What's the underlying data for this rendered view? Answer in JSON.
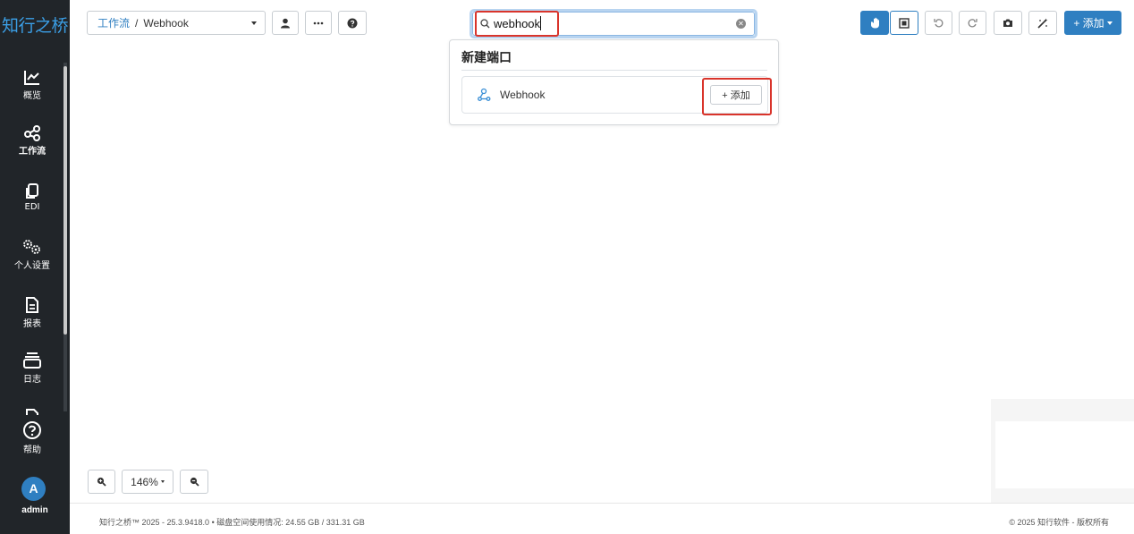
{
  "sidebar": {
    "logo": "知行之桥",
    "items": [
      {
        "label": "概览",
        "icon": "chart-line-icon"
      },
      {
        "label": "工作流",
        "icon": "share-nodes-icon"
      },
      {
        "label": "EDI",
        "icon": "copy-icon"
      },
      {
        "label": "个人设置",
        "icon": "gears-icon"
      },
      {
        "label": "报表",
        "icon": "file-lines-icon"
      },
      {
        "label": "日志",
        "icon": "stack-icon"
      },
      {
        "label": "帮助",
        "icon": "question-circle-icon"
      }
    ],
    "user": {
      "initial": "A",
      "name": "admin"
    }
  },
  "toolbar": {
    "breadcrumb_root": "工作流",
    "breadcrumb_sep": "/",
    "breadcrumb_current": "Webhook",
    "add_label": "+ 添加"
  },
  "search": {
    "value": "webhook"
  },
  "dropdown": {
    "section_title": "新建端口",
    "items": [
      {
        "label": "Webhook",
        "add_label": "+ 添加"
      }
    ]
  },
  "zoom": {
    "level": "146%"
  },
  "footer": {
    "left": "知行之桥™ 2025 - 25.3.9418.0 • 磁盘空间使用情况: 24.55 GB / 331.31 GB",
    "right": "© 2025 知行软件 - 版权所有"
  },
  "colors": {
    "accent": "#2f7fc1",
    "sidebar_bg": "#212529",
    "highlight": "#d9342b"
  }
}
